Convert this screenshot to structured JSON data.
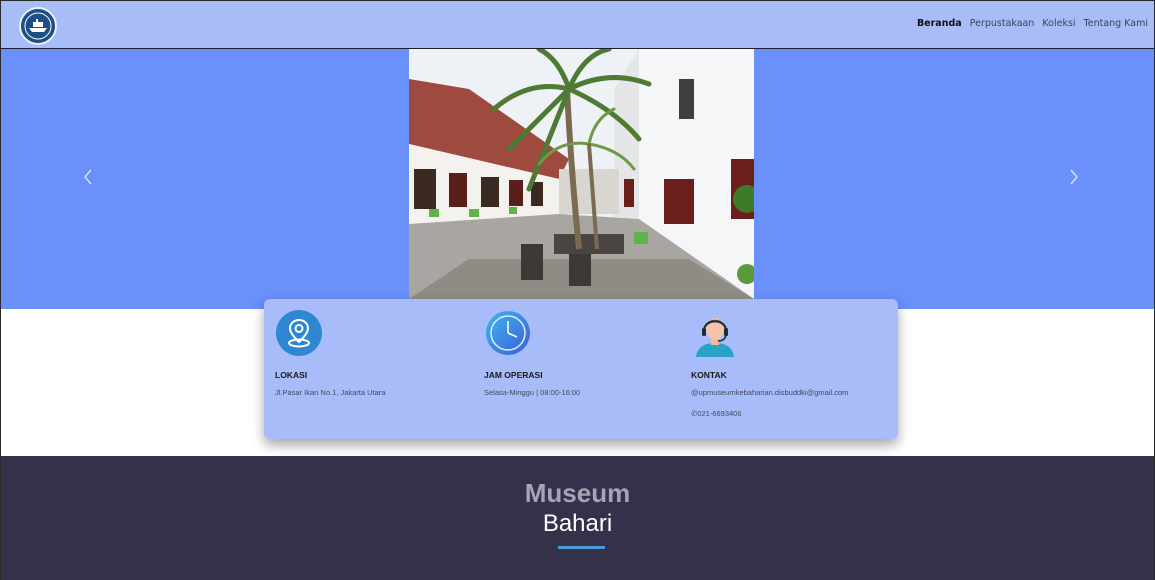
{
  "nav": {
    "logo_icon": "museum-logo-icon",
    "links": [
      {
        "label": "Beranda",
        "active": true
      },
      {
        "label": "Perpustakaan",
        "active": false
      },
      {
        "label": "Koleksi",
        "active": false
      },
      {
        "label": "Tentang Kami",
        "active": false
      }
    ]
  },
  "hero": {
    "image_icon": "museum-courtyard-photo",
    "prev_icon": "chevron-left-icon",
    "next_icon": "chevron-right-icon"
  },
  "info": {
    "lokasi": {
      "icon": "location-pin-icon",
      "title": "LOKASI",
      "text": "Jl.Pasar Ikan No.1, Jakarta Utara"
    },
    "jam": {
      "icon": "clock-icon",
      "title": "JAM OPERASI",
      "text": "Selasa-Minggu | 08:00-16:00"
    },
    "kontak": {
      "icon": "customer-service-icon",
      "title": "KONTAK",
      "email": "@upmuseumkebaharian.disbuddki@gmail.com",
      "phone": "021-6693406"
    }
  },
  "band": {
    "line1": "Museum",
    "line2": "Bahari"
  },
  "colors": {
    "navbar": "#a8bdf7",
    "hero": "#6a90fc",
    "card": "#a7bcf8",
    "band": "#34314b",
    "accent": "#4d9ad8"
  }
}
